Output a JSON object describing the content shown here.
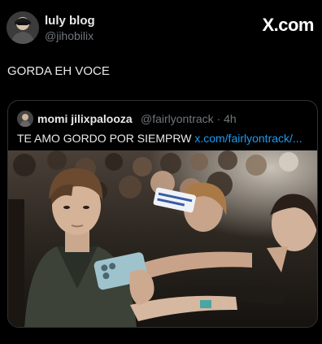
{
  "author": {
    "display_name": "luly blog",
    "handle": "@jihobilix"
  },
  "brand": {
    "label": "X.com"
  },
  "tweet": {
    "text": "GORDA EH VOCE"
  },
  "quoted_tweet": {
    "display_name": "momi jilixpalooza",
    "handle": "@fairlyontrack",
    "separator": "·",
    "time_ago": "4h",
    "text": "TE AMO GORDO POR SIEMPRW",
    "link_text": "x.com/fairlyontrack/..."
  },
  "colors": {
    "background": "#000000",
    "text_primary": "#e7e9ea",
    "text_secondary": "#71767b",
    "link": "#1d9bf0",
    "card_border": "#2f3336"
  },
  "icons": {
    "author_avatar": "avatar-photo",
    "quoted_avatar": "avatar-photo"
  }
}
